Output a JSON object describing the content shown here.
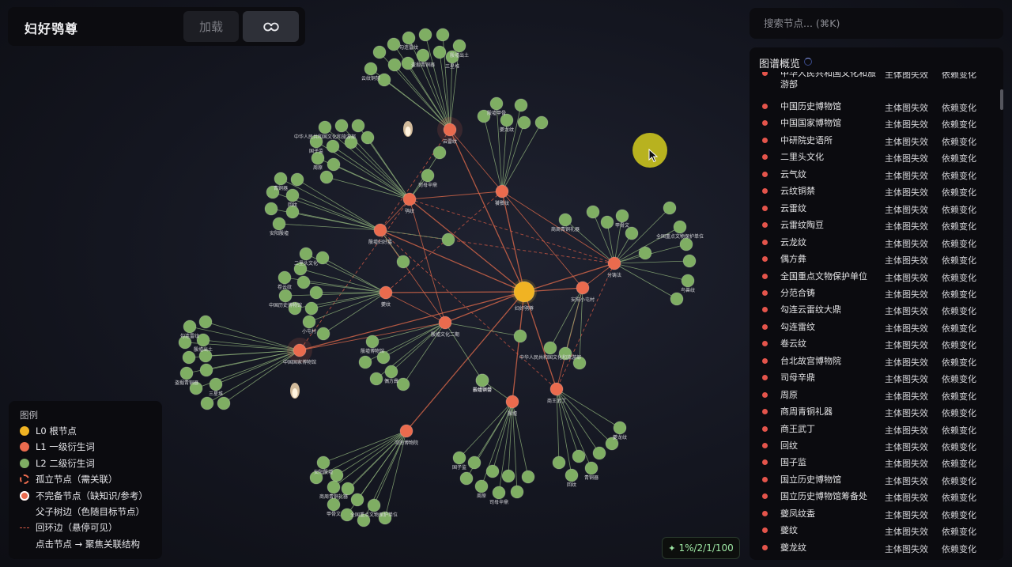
{
  "app": {
    "title": "妇好鸮尊"
  },
  "toolbar": {
    "load_label": "加载",
    "link_icon": "link-icon"
  },
  "search": {
    "placeholder": "搜索节点... (⌘K)"
  },
  "overview": {
    "title": "图谱概览",
    "rows": [
      {
        "name": "中华人民共和国文化和旅游部",
        "status": "主体图失效",
        "dependency": "依赖变化"
      },
      {
        "name": "中国历史博物馆",
        "status": "主体图失效",
        "dependency": "依赖变化"
      },
      {
        "name": "中国国家博物馆",
        "status": "主体图失效",
        "dependency": "依赖变化"
      },
      {
        "name": "中研院史语所",
        "status": "主体图失效",
        "dependency": "依赖变化"
      },
      {
        "name": "二里头文化",
        "status": "主体图失效",
        "dependency": "依赖变化"
      },
      {
        "name": "云气纹",
        "status": "主体图失效",
        "dependency": "依赖变化"
      },
      {
        "name": "云纹铜禁",
        "status": "主体图失效",
        "dependency": "依赖变化"
      },
      {
        "name": "云雷纹",
        "status": "主体图失效",
        "dependency": "依赖变化"
      },
      {
        "name": "云雷纹陶豆",
        "status": "主体图失效",
        "dependency": "依赖变化"
      },
      {
        "name": "云龙纹",
        "status": "主体图失效",
        "dependency": "依赖变化"
      },
      {
        "name": "偶方彝",
        "status": "主体图失效",
        "dependency": "依赖变化"
      },
      {
        "name": "全国重点文物保护单位",
        "status": "主体图失效",
        "dependency": "依赖变化"
      },
      {
        "name": "分范合铸",
        "status": "主体图失效",
        "dependency": "依赖变化"
      },
      {
        "name": "勾连云雷纹大鼎",
        "status": "主体图失效",
        "dependency": "依赖变化"
      },
      {
        "name": "勾连雷纹",
        "status": "主体图失效",
        "dependency": "依赖变化"
      },
      {
        "name": "卷云纹",
        "status": "主体图失效",
        "dependency": "依赖变化"
      },
      {
        "name": "台北故宫博物院",
        "status": "主体图失效",
        "dependency": "依赖变化"
      },
      {
        "name": "司母辛鼎",
        "status": "主体图失效",
        "dependency": "依赖变化"
      },
      {
        "name": "周原",
        "status": "主体图失效",
        "dependency": "依赖变化"
      },
      {
        "name": "商周青铜礼器",
        "status": "主体图失效",
        "dependency": "依赖变化"
      },
      {
        "name": "商王武丁",
        "status": "主体图失效",
        "dependency": "依赖变化"
      },
      {
        "name": "回纹",
        "status": "主体图失效",
        "dependency": "依赖变化"
      },
      {
        "name": "国子监",
        "status": "主体图失效",
        "dependency": "依赖变化"
      },
      {
        "name": "国立历史博物馆",
        "status": "主体图失效",
        "dependency": "依赖变化"
      },
      {
        "name": "国立历史博物馆筹备处",
        "status": "主体图失效",
        "dependency": "依赖变化"
      },
      {
        "name": "夔凤纹盉",
        "status": "主体图失效",
        "dependency": "依赖变化"
      },
      {
        "name": "夔纹",
        "status": "主体图失效",
        "dependency": "依赖变化"
      },
      {
        "name": "夔龙纹",
        "status": "主体图失效",
        "dependency": "依赖变化"
      }
    ]
  },
  "legend": {
    "title": "图例",
    "items": [
      {
        "swatch": "l0",
        "label": "L0 根节点"
      },
      {
        "swatch": "l1",
        "label": "L1 一级衍生词"
      },
      {
        "swatch": "l2",
        "label": "L2 二级衍生词"
      },
      {
        "swatch": "isolated",
        "label": "孤立节点（需关联）"
      },
      {
        "swatch": "incomplete",
        "label": "不完备节点（缺知识/参考）"
      },
      {
        "swatch": "tree-edge",
        "label": "父子树边（色随目标节点）"
      },
      {
        "swatch": "cycle-edge",
        "label": "回环边（悬停可见）"
      },
      {
        "swatch": "none",
        "label": "点击节点 → 聚焦关联结构"
      }
    ]
  },
  "status": {
    "icon": "sparkle-icon",
    "text": "1%/2/1/100"
  },
  "colors": {
    "l0": "#f0b323",
    "l1": "#ea6b4e",
    "l2": "#7fae63",
    "tree_edge_l2": "#8fb27a",
    "tree_edge_l1": "#d9684a",
    "cycle_edge": "#d65a45",
    "accent_status": "#9ee7a4"
  },
  "graph": {
    "root": {
      "label": "妇好鸮尊"
    },
    "l1_nodes": [
      {
        "label": "云雷纹"
      },
      {
        "label": "鸮纹"
      },
      {
        "label": "饕餮纹"
      },
      {
        "label": "殷墟妇好墓"
      },
      {
        "label": "分铸法"
      },
      {
        "label": "安阳小屯村"
      },
      {
        "label": "夔纹"
      },
      {
        "label": "殷墟文化二期"
      },
      {
        "label": "中国国家博物馆"
      },
      {
        "label": "商王武丁"
      },
      {
        "label": "殷墟"
      },
      {
        "label": "河南博物院"
      }
    ],
    "l2_labels": [
      "云纹铜禁",
      "勾连雷纹",
      "殷墟出土",
      "盗掘青铜器",
      "三星堆",
      "中华人民共和国文化和旅游部",
      "国子监",
      "周原",
      "司母辛鼎",
      "殷墟甲骨",
      "夔龙纹",
      "青铜器",
      "回纹",
      "安阳殷墟",
      "商周青铜礼器",
      "甲骨文",
      "全国重点文物保护单位",
      "鸟兽纹",
      "二里头文化",
      "卷云纹",
      "中国历史博物馆",
      "小屯村",
      "殷墟博物馆",
      "偶方彝"
    ]
  }
}
